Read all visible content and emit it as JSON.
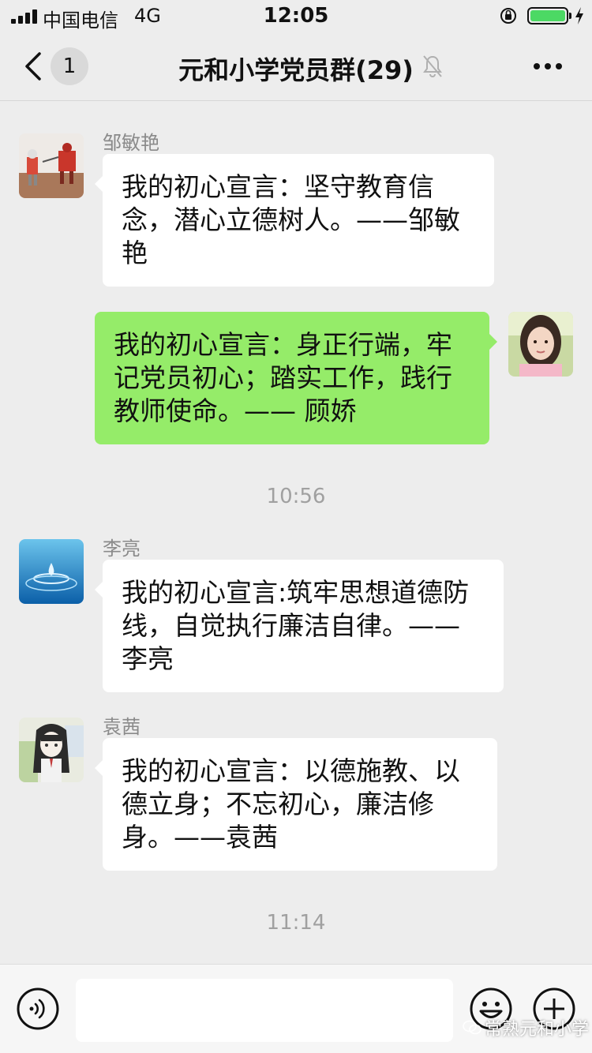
{
  "status_bar": {
    "carrier": "中国电信",
    "network": "4G",
    "time": "12:05",
    "battery_level": 1.0,
    "battery_color": "#4cd964"
  },
  "nav": {
    "back_icon": "chevron-left-icon",
    "unread_count": "1",
    "title": "元和小学党员群(29)",
    "mute_icon": "bell-muted-icon",
    "more_icon": "more-dots-icon"
  },
  "messages": [
    {
      "sender": "邹敏艳",
      "text": "我的初心宣言：坚守教育信念，潜心立德树人。——邹敏艳",
      "side": "left",
      "avatar": "robot-toys-avatar"
    },
    {
      "sender": "",
      "text": "我的初心宣言：身正行端，牢记党员初心；踏实工作，践行教师使命。—— 顾娇",
      "side": "right",
      "avatar": "girl-photo-avatar"
    },
    {
      "timestamp": "10:56"
    },
    {
      "sender": "李亮",
      "text": "我的初心宣言:筑牢思想道德防线，自觉执行廉洁自律。——李亮",
      "side": "left",
      "avatar": "water-drop-avatar"
    },
    {
      "sender": "袁茜",
      "text": "我的初心宣言：以德施教、以德立身；不忘初心，廉洁修身。——袁茜",
      "side": "left",
      "avatar": "anime-girl-avatar"
    },
    {
      "timestamp": "11:14"
    }
  ],
  "input_bar": {
    "voice_icon": "voice-icon",
    "input_value": "",
    "emoji_icon": "emoji-icon",
    "plus_icon": "plus-icon"
  },
  "watermark": "常熟元和小学",
  "colors": {
    "background": "#ededed",
    "bubble_self": "#95ec69",
    "bubble_other": "#ffffff"
  }
}
